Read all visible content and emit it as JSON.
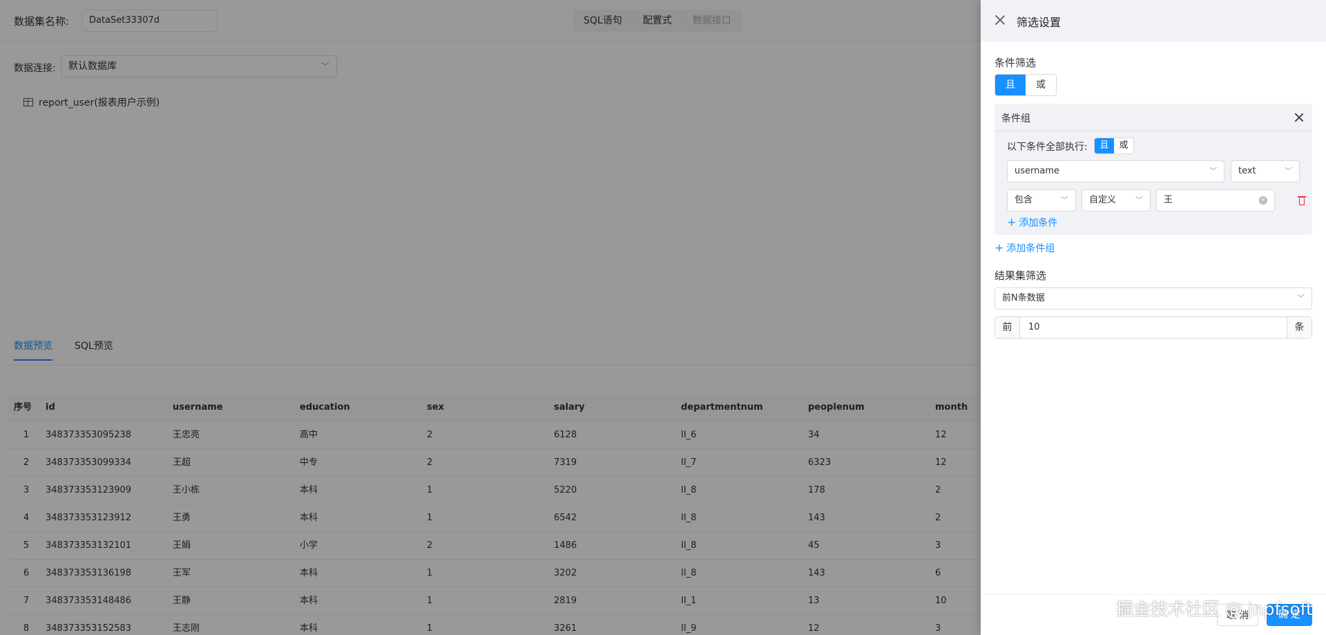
{
  "dataset": {
    "name_label": "数据集名称:",
    "name_value": "DataSet33307d",
    "mode_tabs": [
      "SQL语句",
      "配置式",
      "数据接口"
    ]
  },
  "connection": {
    "label": "数据连接:",
    "value": "默认数据库"
  },
  "tree": {
    "table_item": "report_user(报表用户示例)"
  },
  "preview_tabs": [
    "数据预览",
    "SQL预览"
  ],
  "grid": {
    "columns": [
      "序号",
      "id",
      "username",
      "education",
      "sex",
      "salary",
      "departmentnum",
      "peoplenum",
      "month"
    ],
    "rows": [
      [
        "1",
        "348373353095238",
        "王忠亮",
        "高中",
        "2",
        "6128",
        "II_6",
        "34",
        "12"
      ],
      [
        "2",
        "348373353099334",
        "王超",
        "中专",
        "2",
        "7319",
        "II_7",
        "6323",
        "12"
      ],
      [
        "3",
        "348373353123909",
        "王小栋",
        "本科",
        "1",
        "5220",
        "II_8",
        "178",
        "2"
      ],
      [
        "4",
        "348373353123912",
        "王勇",
        "本科",
        "1",
        "6542",
        "II_8",
        "143",
        "2"
      ],
      [
        "5",
        "348373353132101",
        "王娟",
        "小学",
        "2",
        "1486",
        "II_8",
        "45",
        "3"
      ],
      [
        "6",
        "348373353136198",
        "王军",
        "本科",
        "1",
        "3202",
        "II_8",
        "143",
        "6"
      ],
      [
        "7",
        "348373353148486",
        "王静",
        "本科",
        "1",
        "2819",
        "II_1",
        "13",
        "10"
      ],
      [
        "8",
        "348373353152583",
        "王志刚",
        "本科",
        "1",
        "3261",
        "II_9",
        "12",
        "3"
      ]
    ]
  },
  "drawer": {
    "title": "筛选设置",
    "condition_filter_title": "条件筛选",
    "logic_and": "且",
    "logic_or": "或",
    "group_title": "条件组",
    "exec_label": "以下条件全部执行:",
    "field_select": "username",
    "type_select": "text",
    "operator_select": "包含",
    "value_mode_select": "自定义",
    "value_input": "王",
    "add_condition": "添加条件",
    "add_group": "添加条件组",
    "result_filter_title": "结果集筛选",
    "result_mode_select": "前N条数据",
    "prefix": "前",
    "count_value": "10",
    "suffix": "条",
    "cancel": "取 消",
    "ok": "确 定"
  },
  "watermark": "掘金技术社区 @ jnpfsoft"
}
